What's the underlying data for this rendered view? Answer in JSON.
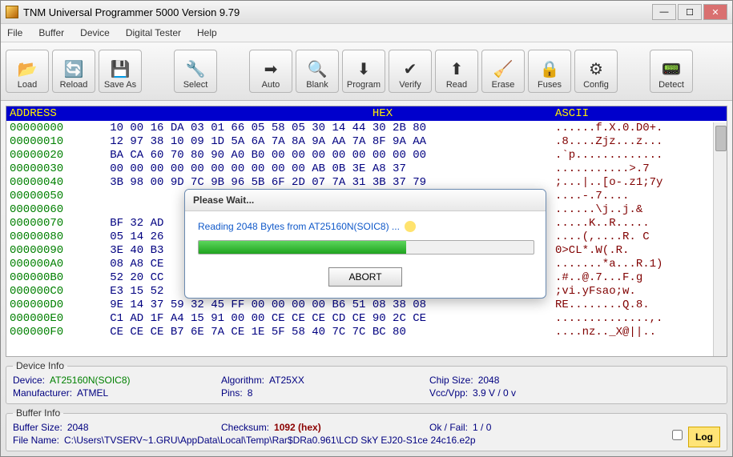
{
  "title": "TNM Universal Programmer 5000   Version 9.79",
  "menu": [
    "File",
    "Buffer",
    "Device",
    "Digital Tester",
    "Help"
  ],
  "toolbar": [
    {
      "label": "Load",
      "icon": "📂"
    },
    {
      "label": "Reload",
      "icon": "🔄"
    },
    {
      "label": "Save As",
      "icon": "💾"
    },
    {
      "gap": true
    },
    {
      "label": "Select",
      "icon": "🔧"
    },
    {
      "gap": true
    },
    {
      "label": "Auto",
      "icon": "➡"
    },
    {
      "label": "Blank",
      "icon": "🔍"
    },
    {
      "label": "Program",
      "icon": "⬇"
    },
    {
      "label": "Verify",
      "icon": "✔"
    },
    {
      "label": "Read",
      "icon": "⬆"
    },
    {
      "label": "Erase",
      "icon": "🧹"
    },
    {
      "label": "Fuses",
      "icon": "🔒"
    },
    {
      "label": "Config",
      "icon": "⚙"
    },
    {
      "gap": true
    },
    {
      "label": "Detect",
      "icon": "📟"
    }
  ],
  "hex_hdr": {
    "addr": "ADDRESS",
    "hex": "HEX",
    "ascii": "ASCII"
  },
  "hex": [
    {
      "a": "00000000",
      "h": "10 00 16 DA 03 01 66 05 58 05 30 14 44 30 2B 80",
      "s": "......f.X.0.D0+."
    },
    {
      "a": "00000010",
      "h": "12 97 38 10 09 1D 5A 6A 7A 8A 9A AA 7A 8F 9A AA",
      "s": ".8....Zjz...z..."
    },
    {
      "a": "00000020",
      "h": "BA CA 60 70 80 90 A0 B0 00 00 00 00 00 00 00 00",
      "s": ".`p............."
    },
    {
      "a": "00000030",
      "h": "00 00 00 00 00 00 00 00 00 00 AB 0B 3E A8 37   ",
      "s": "...........>.7"
    },
    {
      "a": "00000040",
      "h": "3B 98 00 9D 7C 9B 96 5B 6F 2D 07 7A 31 3B 37 79",
      "s": ";...|..[o-.z1;7y"
    },
    {
      "a": "00000050",
      "h": "                                               ",
      "s": "....-.7...."
    },
    {
      "a": "00000060",
      "h": "                                               ",
      "s": "......\\j..j.&"
    },
    {
      "a": "00000070",
      "h": "BF 32 AD                                        ",
      "s": ".....K..R....."
    },
    {
      "a": "00000080",
      "h": "05 14 26                                        ",
      "s": "....(,....R. C"
    },
    {
      "a": "00000090",
      "h": "3E 40 B3                                        ",
      "s": "0>CL*.W(.R."
    },
    {
      "a": "000000A0",
      "h": "08 A8 CE                                        ",
      "s": ".......*a...R.1)"
    },
    {
      "a": "000000B0",
      "h": "52 20 CC                                        ",
      "s": ".#..@.7...F.g"
    },
    {
      "a": "000000C0",
      "h": "E3 15 52                                        ",
      "s": ";vi.yFsao;w."
    },
    {
      "a": "000000D0",
      "h": "9E 14 37 59 32 45 FF 00 00 00 00 B6 51 08 38 08",
      "s": "RE........Q.8."
    },
    {
      "a": "000000E0",
      "h": "C1 AD 1F A4 15 91 00 00 CE CE CE CD CE 90 2C CE",
      "s": "..............,."
    },
    {
      "a": "000000F0",
      "h": "CE CE CE B7 6E 7A CE 1E 5F 58 40 7C 7C BC 80   ",
      "s": "....nz.._X@||.."
    }
  ],
  "device_info": {
    "title": "Device Info",
    "device_lab": "Device:",
    "device_val": "AT25160N(SOIC8)",
    "algo_lab": "Algorithm:",
    "algo_val": "AT25XX",
    "chip_lab": "Chip Size:",
    "chip_val": "2048",
    "mfr_lab": "Manufacturer:",
    "mfr_val": "ATMEL",
    "pins_lab": "Pins:",
    "pins_val": "8",
    "vcc_lab": "Vcc/Vpp:",
    "vcc_val": "3.9 V / 0 v"
  },
  "buffer_info": {
    "title": "Buffer Info",
    "buf_lab": "Buffer Size:",
    "buf_val": "2048",
    "chk_lab": "Checksum:",
    "chk_val": "1092 (hex)",
    "ok_lab": "Ok / Fail:",
    "ok_val": "1 / 0",
    "file_lab": "File Name:",
    "file_val": "C:\\Users\\TVSERV~1.GRU\\AppData\\Local\\Temp\\Rar$DRa0.961\\LCD SkY  EJ20-S1ce 24c16.e2p",
    "log": "Log"
  },
  "modal": {
    "title": "Please Wait...",
    "msg": "Reading 2048 Bytes from AT25160N(SOIC8) ...",
    "abort": "ABORT",
    "progress_pct": 62
  }
}
